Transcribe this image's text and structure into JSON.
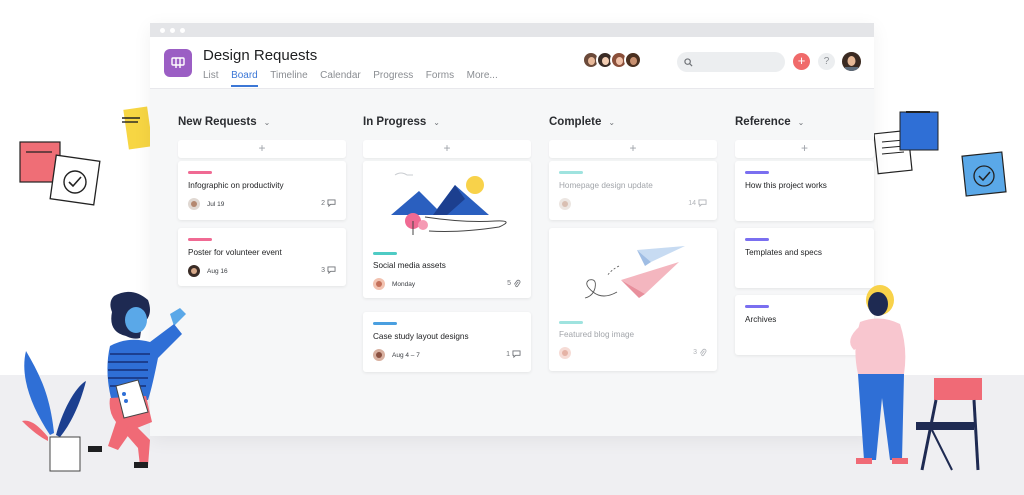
{
  "project": {
    "title": "Design Requests",
    "icon": "board-icon",
    "icon_color": "#9b5ec4"
  },
  "tabs": [
    {
      "label": "List",
      "active": false
    },
    {
      "label": "Board",
      "active": true
    },
    {
      "label": "Timeline",
      "active": false
    },
    {
      "label": "Calendar",
      "active": false
    },
    {
      "label": "Progress",
      "active": false
    },
    {
      "label": "Forms",
      "active": false
    },
    {
      "label": "More...",
      "active": false
    }
  ],
  "toolbar": {
    "add_label": "+",
    "help_label": "?"
  },
  "colors": {
    "accent": "#3c77d6",
    "add_button": "#f06a6a",
    "tag_pink": "#f06a93",
    "tag_teal": "#4ecbc4",
    "tag_blue": "#4a9fe0",
    "tag_purple": "#7a6ff0"
  },
  "board": {
    "add_symbol": "+",
    "columns": [
      {
        "name": "New Requests",
        "cards": [
          {
            "title": "Infographic on productivity",
            "date": "Jul 19",
            "count": "2",
            "count_icon": "comment-icon",
            "tag_color": "#f06a93"
          },
          {
            "title": "Poster for volunteer event",
            "date": "Aug 16",
            "count": "3",
            "count_icon": "comment-icon",
            "tag_color": "#f06a93"
          }
        ]
      },
      {
        "name": "In Progress",
        "cards": [
          {
            "title": "Social media assets",
            "date": "Monday",
            "count": "5",
            "count_icon": "paperclip-icon",
            "tag_color": "#4ecbc4",
            "image": "mountain-landscape-illustration"
          },
          {
            "title": "Case study layout designs",
            "date": "Aug 4 – 7",
            "count": "1",
            "count_icon": "comment-icon",
            "tag_color": "#4a9fe0"
          }
        ]
      },
      {
        "name": "Complete",
        "cards": [
          {
            "title": "Homepage design update",
            "date": "",
            "count": "14",
            "count_icon": "comment-icon",
            "tag_color": "#4ecbc4",
            "completed": true
          },
          {
            "title": "Featured blog image",
            "date": "",
            "count": "3",
            "count_icon": "paperclip-icon",
            "tag_color": "#4ecbc4",
            "completed": true,
            "image": "paper-planes-illustration"
          }
        ]
      },
      {
        "name": "Reference",
        "cards": [
          {
            "title": "How this project works",
            "tag_color": "#7a6ff0"
          },
          {
            "title": "Templates and specs",
            "tag_color": "#7a6ff0"
          },
          {
            "title": "Archives",
            "tag_color": "#7a6ff0"
          }
        ]
      }
    ]
  }
}
